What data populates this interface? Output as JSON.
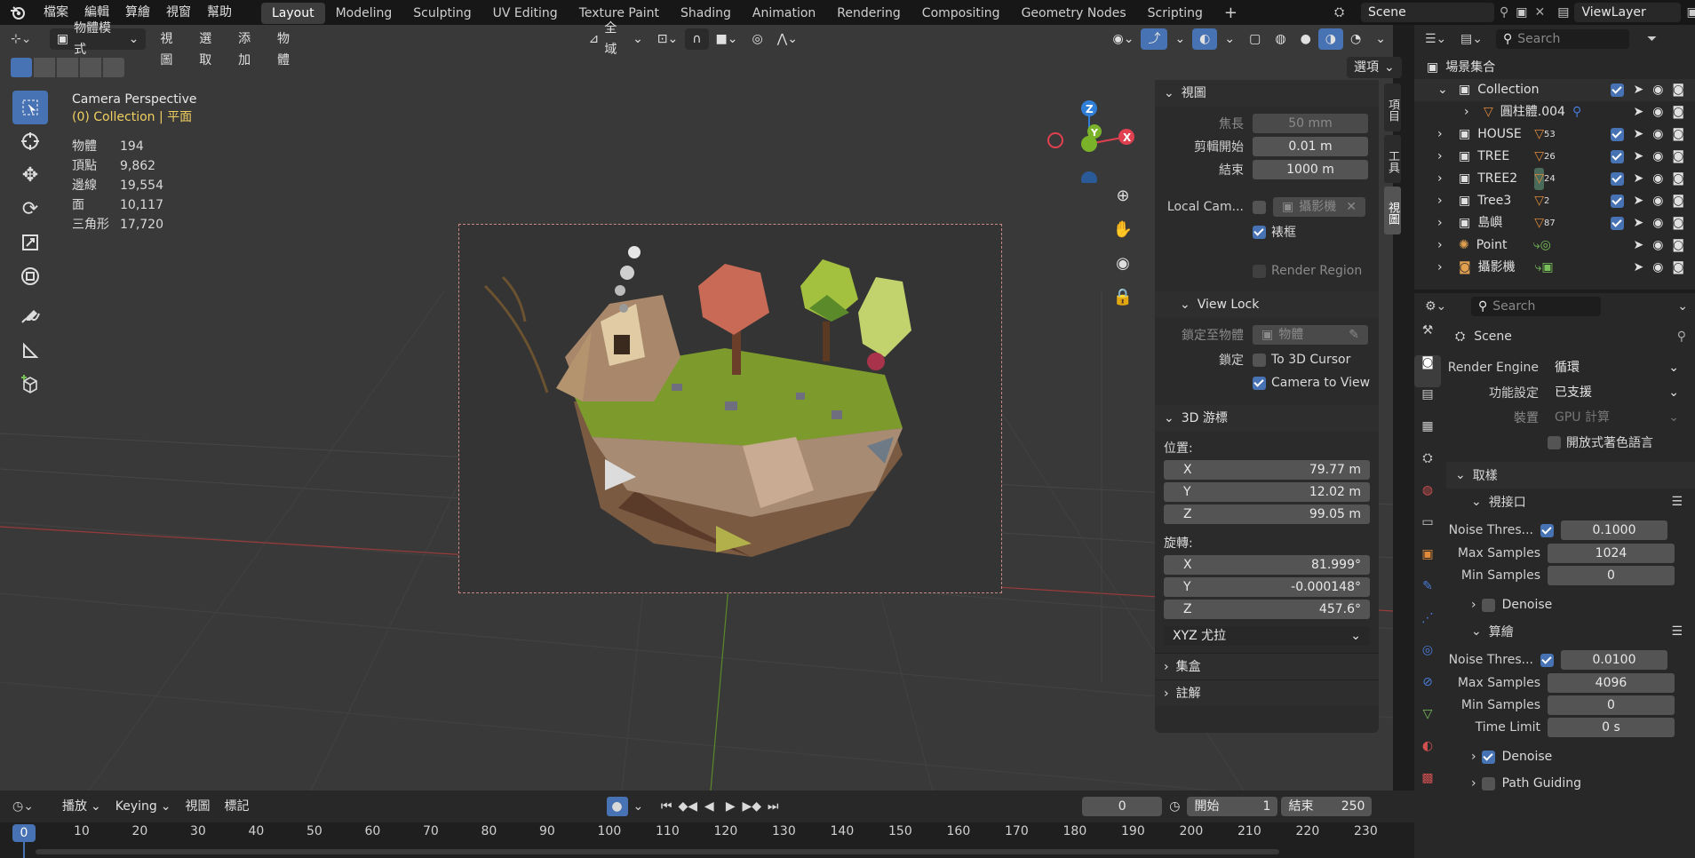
{
  "app": {
    "menus": [
      "檔案",
      "編輯",
      "算繪",
      "視窗",
      "幫助"
    ],
    "workspaces": [
      "Layout",
      "Modeling",
      "Sculpting",
      "UV Editing",
      "Texture Paint",
      "Shading",
      "Animation",
      "Rendering",
      "Compositing",
      "Geometry Nodes",
      "Scripting"
    ],
    "active_workspace": "Layout",
    "add_tab": "+",
    "scene_name": "Scene",
    "view_layer": "ViewLayer"
  },
  "viewport_header": {
    "mode": "物體模式",
    "menus": [
      "視圖",
      "選取",
      "添加",
      "物體"
    ],
    "transform_orientation": "全域",
    "options": "選項"
  },
  "overlay": {
    "camera_title": "Camera Perspective",
    "collection_line": "(0) Collection | 平面",
    "stats": [
      {
        "label": "物體",
        "value": "194"
      },
      {
        "label": "頂點",
        "value": "9,862"
      },
      {
        "label": "邊線",
        "value": "19,554"
      },
      {
        "label": "面",
        "value": "10,117"
      },
      {
        "label": "三角形",
        "value": "17,720"
      }
    ],
    "axes": {
      "x": "X",
      "y": "Y",
      "z": "Z"
    }
  },
  "npanel": {
    "tabs": [
      "項目",
      "工具",
      "視圖"
    ],
    "view_section": "視圖",
    "focal_label": "焦長",
    "focal_value": "50 mm",
    "clip_start_label": "剪輯開始",
    "clip_start_value": "0.01 m",
    "clip_end_label": "結束",
    "clip_end_value": "1000 m",
    "local_camera_label": "Local Cam...",
    "local_camera_value": "攝影機",
    "frame_label": "裱框",
    "render_region_label": "Render Region",
    "view_lock_section": "View Lock",
    "lock_object_label": "鎖定至物體",
    "lock_object_placeholder": "物體",
    "lock_label": "鎖定",
    "to_3d_cursor": "To 3D Cursor",
    "camera_to_view": "Camera to View",
    "cursor_section": "3D 游標",
    "location_label": "位置:",
    "loc_x": "79.77 m",
    "loc_y": "12.02 m",
    "loc_z": "99.05 m",
    "rotation_label": "旋轉:",
    "rot_x": "81.999°",
    "rot_y": "-0.000148°",
    "rot_z": "457.6°",
    "rotation_mode": "XYZ 尤拉",
    "collection_section": "集盒",
    "annotation_section": "註解",
    "x": "X",
    "y": "Y",
    "z": "Z"
  },
  "outliner": {
    "search_placeholder": "Search",
    "root": "場景集合",
    "items": [
      {
        "name": "Collection",
        "badge": ""
      },
      {
        "name": "圓柱體.004",
        "badge": ""
      },
      {
        "name": "HOUSE",
        "badge": "53"
      },
      {
        "name": "TREE",
        "badge": "26"
      },
      {
        "name": "TREE2",
        "badge": "24"
      },
      {
        "name": "Tree3",
        "badge": "2"
      },
      {
        "name": "島嶼",
        "badge": "87"
      },
      {
        "name": "Point",
        "badge": ""
      },
      {
        "name": "攝影機",
        "badge": ""
      }
    ]
  },
  "properties": {
    "search_placeholder": "Search",
    "scene": "Scene",
    "render_engine_label": "Render Engine",
    "render_engine_value": "循環",
    "feature_set_label": "功能設定",
    "feature_set_value": "已支援",
    "device_label": "裝置",
    "device_value": "GPU 計算",
    "osl_label": "開放式著色語言",
    "sampling_section": "取樣",
    "viewport_section": "視接口",
    "vp_noise_label": "Noise Thres...",
    "vp_noise_value": "0.1000",
    "vp_max_label": "Max Samples",
    "vp_max_value": "1024",
    "vp_min_label": "Min Samples",
    "vp_min_value": "0",
    "vp_denoise": "Denoise",
    "render_section": "算繪",
    "r_noise_label": "Noise Thres...",
    "r_noise_value": "0.0100",
    "r_max_label": "Max Samples",
    "r_max_value": "4096",
    "r_min_label": "Min Samples",
    "r_min_value": "0",
    "r_time_label": "Time Limit",
    "r_time_value": "0 s",
    "r_denoise": "Denoise",
    "path_guiding": "Path Guiding"
  },
  "timeline": {
    "playback": "播放",
    "keying": "Keying",
    "view": "視圖",
    "marker": "標記",
    "current_frame": "0",
    "start_label": "開始",
    "start_value": "1",
    "end_label": "結束",
    "end_value": "250",
    "playhead": "0",
    "ticks": [
      "10",
      "20",
      "30",
      "40",
      "50",
      "60",
      "70",
      "80",
      "90",
      "100",
      "110",
      "120",
      "130",
      "140",
      "150",
      "160",
      "170",
      "180",
      "190",
      "200",
      "210",
      "220",
      "230"
    ]
  },
  "colors": {
    "accent": "#4772b3",
    "axis_x": "#e0404f",
    "axis_y": "#7ab32a",
    "axis_z": "#2f7fd9"
  }
}
